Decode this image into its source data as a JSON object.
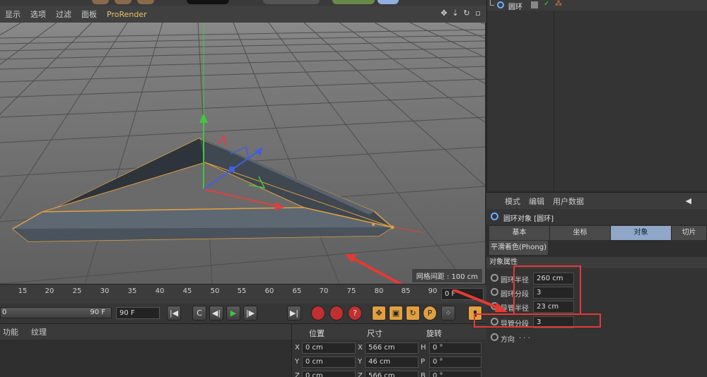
{
  "viewport": {
    "menu": [
      "显示",
      "选项",
      "过滤",
      "面板",
      "ProRender"
    ],
    "grid_spacing": "网格间距 : 100 cm"
  },
  "timeline": {
    "ticks": [
      "15",
      "20",
      "25",
      "30",
      "35",
      "40",
      "45",
      "50",
      "55",
      "60",
      "65",
      "70",
      "75",
      "80",
      "85",
      "90"
    ],
    "current_frame": "0 F"
  },
  "transport": {
    "range_start": "0",
    "range_end": "90 F",
    "end_field": "90 F",
    "buttons": [
      "|◀",
      "C",
      "◀|",
      "▶",
      "|▶",
      "▶|"
    ]
  },
  "material_panel": {
    "tabs": [
      "功能",
      "纹理"
    ]
  },
  "coordinates": {
    "headers": [
      "位置",
      "尺寸",
      "旋转"
    ],
    "rows": [
      {
        "axis": "X",
        "position": "0 cm",
        "size_axis": "X",
        "size": "566 cm",
        "rot_axis": "H",
        "rotation": "0 °"
      },
      {
        "axis": "Y",
        "position": "0 cm",
        "size_axis": "Y",
        "size": "46 cm",
        "rot_axis": "P",
        "rotation": "0 °"
      },
      {
        "axis": "Z",
        "position": "0 cm",
        "size_axis": "Z",
        "size": "566 cm",
        "rot_axis": "B",
        "rotation": "0 °"
      }
    ]
  },
  "object_manager": {
    "object_name": "圆环"
  },
  "attributes": {
    "header": [
      "模式",
      "编辑",
      "用户数据"
    ],
    "title": "圆环对象 [圆环]",
    "tabs": [
      "基本",
      "坐标",
      "对象",
      "切片"
    ],
    "active_tab": "对象",
    "subtab": "平滑着色(Phong)",
    "section": "对象属性",
    "params": [
      {
        "label": "圆环半径",
        "value": "260 cm"
      },
      {
        "label": "圆环分段",
        "value": "3"
      },
      {
        "label": "导管半径",
        "value": "23 cm"
      },
      {
        "label": "导管分段",
        "value": "3"
      },
      {
        "label": "方向",
        "value": ""
      }
    ]
  },
  "colors": {
    "accent_orange": "#e0a040",
    "axis_green": "#3ec83e",
    "axis_red": "#e04040",
    "axis_blue": "#4060e0",
    "annotation_red": "#e53935",
    "active_tab": "#8fa8c8"
  }
}
